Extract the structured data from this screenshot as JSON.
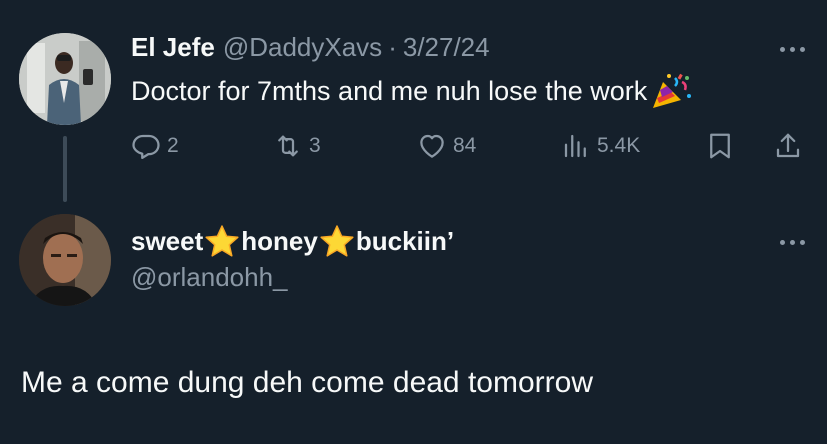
{
  "tweet1": {
    "display_name": "El Jefe",
    "handle": "@DaddyXavs",
    "separator": "·",
    "date": "3/27/24",
    "text": "Doctor for 7mths and me nuh lose the work",
    "emoji": "party-popper",
    "actions": {
      "replies": "2",
      "retweets": "3",
      "likes": "84",
      "views": "5.4K"
    }
  },
  "tweet2": {
    "display_name_parts": [
      "sweet",
      "honey",
      "buckiin’"
    ],
    "emoji": "star",
    "handle": "@orlandohh_",
    "text": "Me a come dung deh come dead tomorrow"
  },
  "colors": {
    "background": "#15202b",
    "primary_text": "#f7f9f9",
    "secondary_text": "#8b98a5",
    "thread_line": "#3d4b58"
  }
}
